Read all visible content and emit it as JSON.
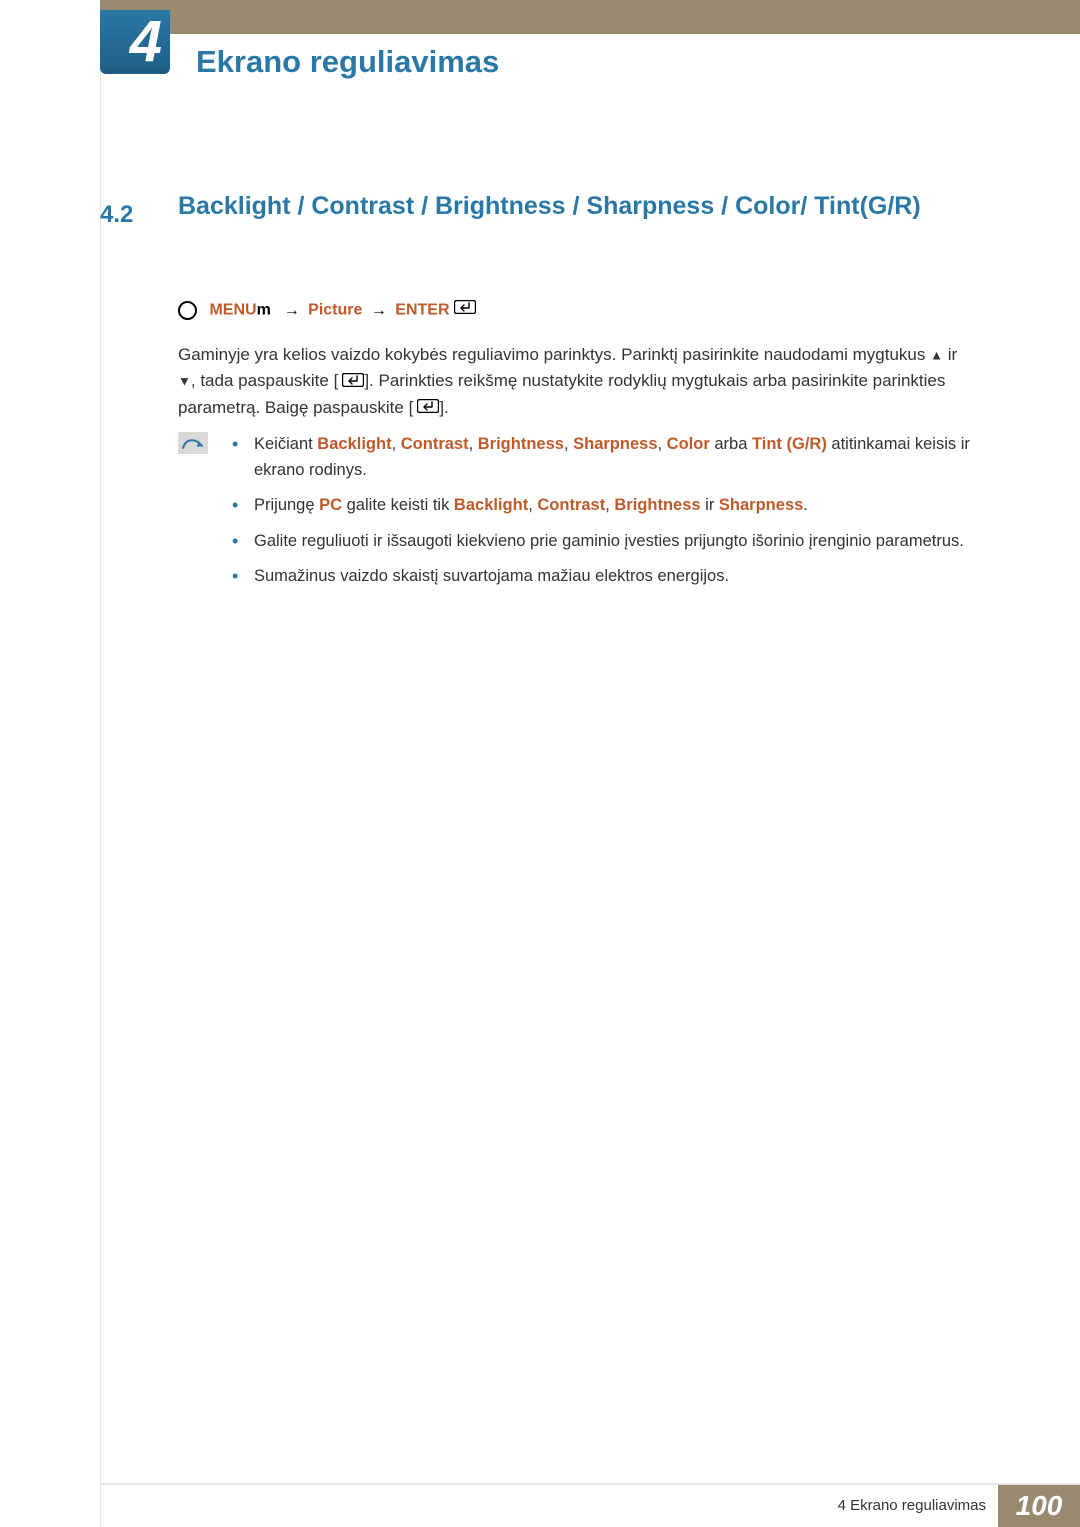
{
  "header": {
    "chapter_tab": "4",
    "chapter_title": "Ekrano reguliavimas"
  },
  "section": {
    "number": "4.2",
    "title": "Backlight / Contrast / Brightness / Sharpness / Color/ Tint(G/R)"
  },
  "nav": {
    "menu": "MENU",
    "m": "m",
    "arrow": "→",
    "picture": "Picture",
    "enter": "ENTER"
  },
  "body": {
    "p1a": "Gaminyje yra kelios vaizdo kokybės reguliavimo parinktys. Parinktį pasirinkite naudodami mygtukus ",
    "p1b": " ir ",
    "p1c": ", tada paspauskite [",
    "p1d": "]. Parinkties reikšmę nustatykite rodyklių mygtukais arba pasirinkite parinkties parametrą. Baigę paspauskite [",
    "p1e": "]."
  },
  "notes": {
    "n1_a": "Keičiant ",
    "n1_backlight": "Backlight",
    "n1_sep": ", ",
    "n1_contrast": "Contrast",
    "n1_brightness": "Brightness",
    "n1_sharpness": "Sharpness",
    "n1_color": "Color",
    "n1_arba": " arba ",
    "n1_tint": "Tint (G/R)",
    "n1_b": " atitinkamai keisis ir ekrano rodinys.",
    "n2_a": "Prijungę ",
    "n2_pc": "PC",
    "n2_b": " galite keisti tik ",
    "n2_c": " ir ",
    "n2_d": ".",
    "n3": "Galite reguliuoti ir išsaugoti kiekvieno prie gaminio įvesties prijungto išorinio įrenginio parametrus.",
    "n4": "Sumažinus vaizdo skaistį suvartojama mažiau elektros energijos."
  },
  "footer": {
    "caption": "4 Ekrano reguliavimas",
    "page": "100"
  }
}
